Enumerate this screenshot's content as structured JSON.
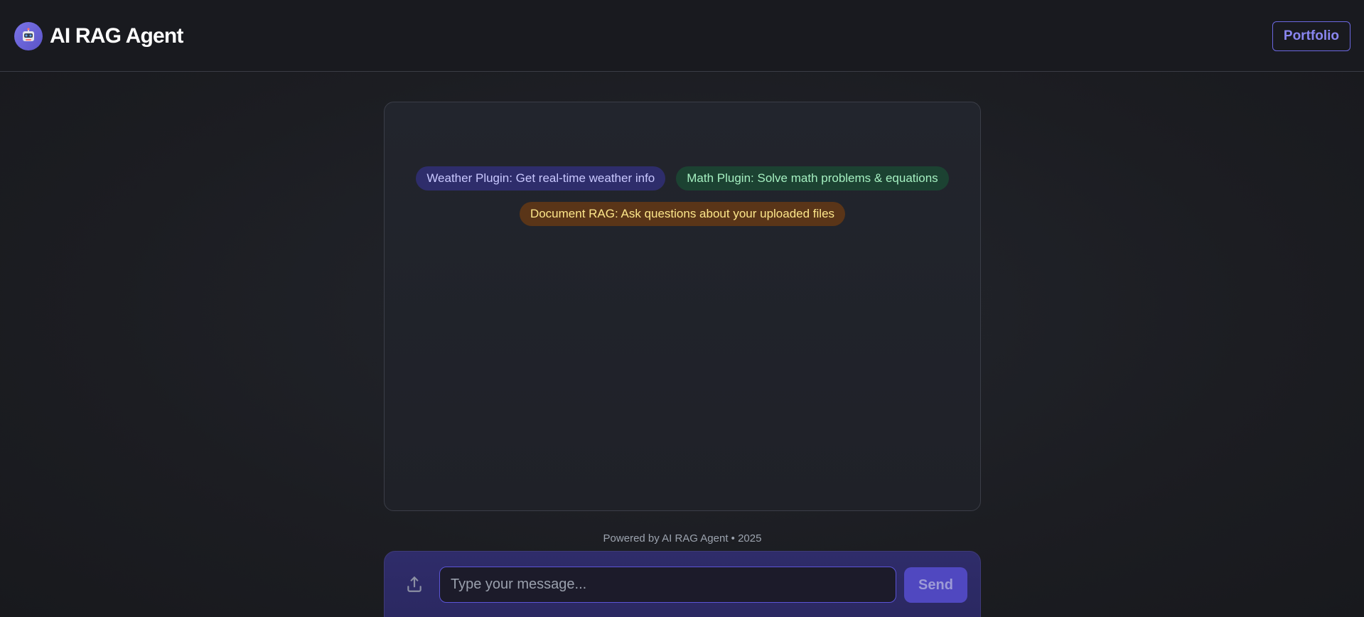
{
  "header": {
    "logo_icon": "robot-icon",
    "title": "AI RAG Agent",
    "portfolio_label": "Portfolio"
  },
  "plugins": [
    {
      "label": "Weather Plugin: Get real-time weather info",
      "color": "#2e2d6b"
    },
    {
      "label": "Math Plugin: Solve math problems & equations",
      "color": "#1c4232"
    },
    {
      "label": "Document RAG: Ask questions about your uploaded files",
      "color": "#5a3518"
    }
  ],
  "footer": {
    "text": "Powered by AI RAG Agent • 2025"
  },
  "composer": {
    "upload_icon": "upload-icon",
    "placeholder": "Type your message...",
    "value": "",
    "send_label": "Send"
  },
  "colors": {
    "accent": "#6b67e0",
    "background": "#1c1d22"
  }
}
